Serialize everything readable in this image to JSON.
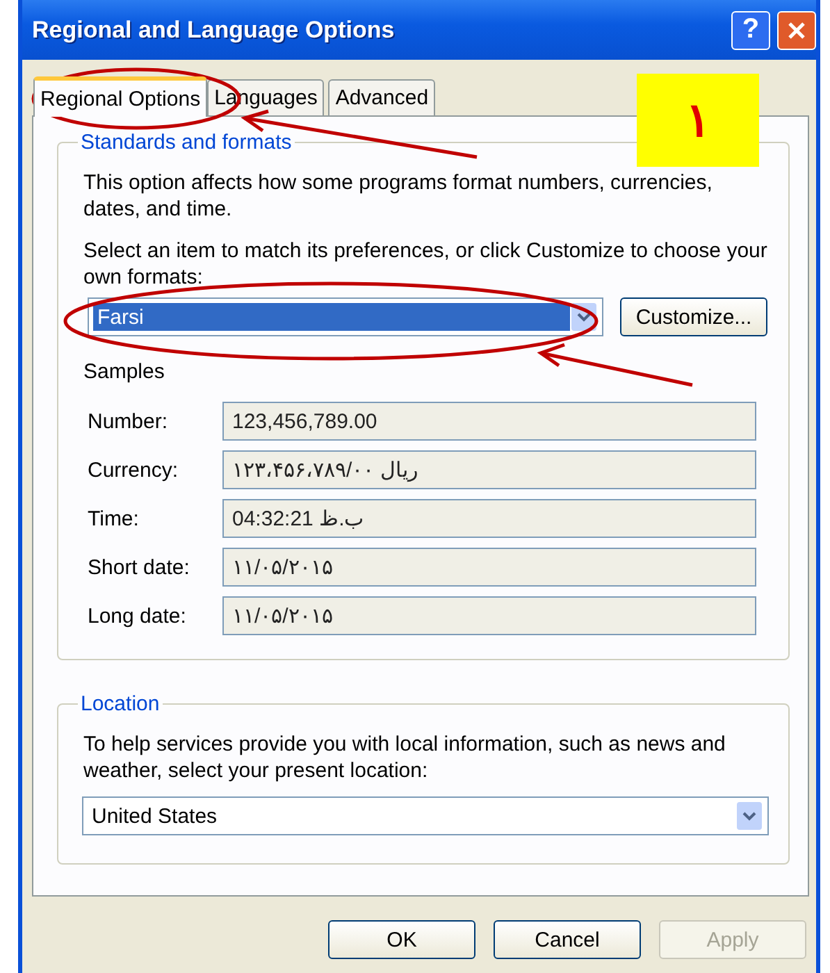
{
  "window": {
    "title": "Regional and Language Options",
    "help_button": "?"
  },
  "tabs": [
    {
      "label": "Regional Options",
      "selected": true
    },
    {
      "label": "Languages",
      "selected": false
    },
    {
      "label": "Advanced",
      "selected": false
    }
  ],
  "standards": {
    "heading": "Standards and formats",
    "description": "This option affects how some programs format numbers, currencies, dates, and time.",
    "instruction": "Select an item to match its preferences, or click Customize to choose your own formats:",
    "format_select": {
      "value": "Farsi",
      "highlighted": true
    },
    "customize_button": "Customize...",
    "samples_label": "Samples",
    "samples": [
      {
        "label": "Number:",
        "value": "123,456,789.00"
      },
      {
        "label": "Currency:",
        "value": "ریال ۱۲۳،۴۵۶،۷۸۹/۰۰"
      },
      {
        "label": "Time:",
        "value": "04:32:21 ب.ظ"
      },
      {
        "label": "Short date:",
        "value": "۱۱/۰۵/۲۰۱۵"
      },
      {
        "label": "Long date:",
        "value": "۱۱/۰۵/۲۰۱۵"
      }
    ]
  },
  "location": {
    "heading": "Location",
    "description": "To help services provide you with local information, such as news and weather, select your present location:",
    "select": {
      "value": "United States",
      "highlighted": false
    }
  },
  "buttons": [
    {
      "label": "OK",
      "disabled": false
    },
    {
      "label": "Cancel",
      "disabled": false
    },
    {
      "label": "Apply",
      "disabled": true
    }
  ],
  "annotation": {
    "note": "١"
  }
}
